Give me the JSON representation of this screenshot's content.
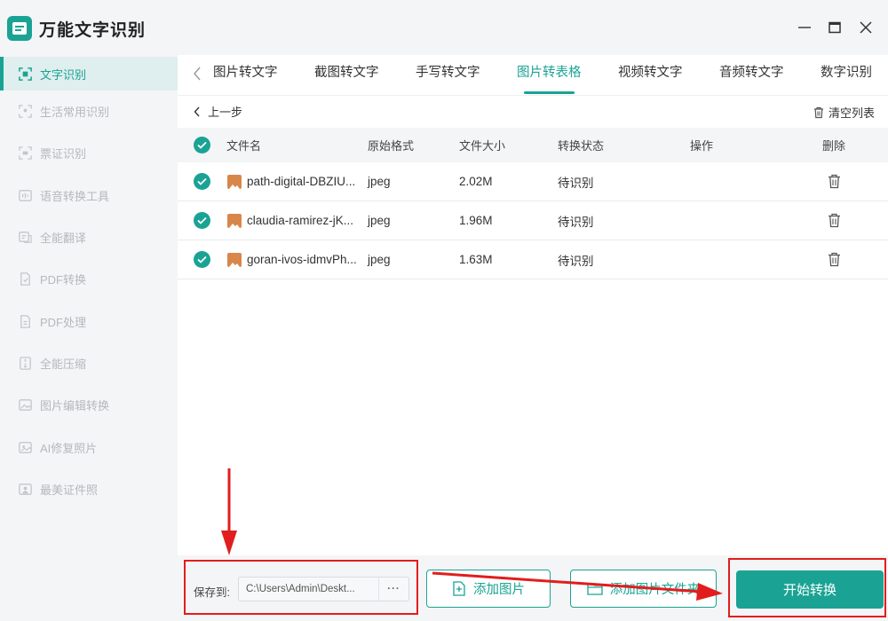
{
  "app": {
    "title": "万能文字识别",
    "accent_color": "#1aa394"
  },
  "sidebar": {
    "items": [
      {
        "label": "文字识别",
        "icon": "text-scan-icon",
        "active": true
      },
      {
        "label": "生活常用识别",
        "icon": "scan-icon"
      },
      {
        "label": "票证识别",
        "icon": "ticket-icon"
      },
      {
        "label": "语音转换工具",
        "icon": "voice-icon"
      },
      {
        "label": "全能翻译",
        "icon": "translate-icon"
      },
      {
        "label": "PDF转换",
        "icon": "pdf-icon"
      },
      {
        "label": "PDF处理",
        "icon": "pdf-process-icon"
      },
      {
        "label": "全能压缩",
        "icon": "compress-icon"
      },
      {
        "label": "图片编辑转换",
        "icon": "image-edit-icon"
      },
      {
        "label": "AI修复照片",
        "icon": "ai-photo-icon"
      },
      {
        "label": "最美证件照",
        "icon": "id-photo-icon"
      }
    ]
  },
  "window_controls": [
    "minimize-icon",
    "maximize-icon",
    "close-icon"
  ],
  "tabs": [
    {
      "label": "图片转文字"
    },
    {
      "label": "截图转文字"
    },
    {
      "label": "手写转文字"
    },
    {
      "label": "图片转表格",
      "active": true
    },
    {
      "label": "视频转文字"
    },
    {
      "label": "音频转文字"
    },
    {
      "label": "数字识别"
    }
  ],
  "toolbar": {
    "back_label": "上一步",
    "clear_label": "清空列表"
  },
  "table": {
    "columns": [
      "文件名",
      "原始格式",
      "文件大小",
      "转换状态",
      "操作",
      "删除"
    ],
    "rows": [
      {
        "name": "path-digital-DBZIU...",
        "format": "jpeg",
        "size": "2.02M",
        "status": "待识别"
      },
      {
        "name": "claudia-ramirez-jK...",
        "format": "jpeg",
        "size": "1.96M",
        "status": "待识别"
      },
      {
        "name": "goran-ivos-idmvPh...",
        "format": "jpeg",
        "size": "1.63M",
        "status": "待识别"
      }
    ]
  },
  "bottom": {
    "save_label": "保存到:",
    "save_path": "C:\\Users\\Admin\\Deskt...",
    "more_label": "···",
    "add_image_label": "添加图片",
    "add_folder_label": "添加图片文件夹",
    "start_label": "开始转换"
  },
  "annotation_color": "#e21d1d"
}
